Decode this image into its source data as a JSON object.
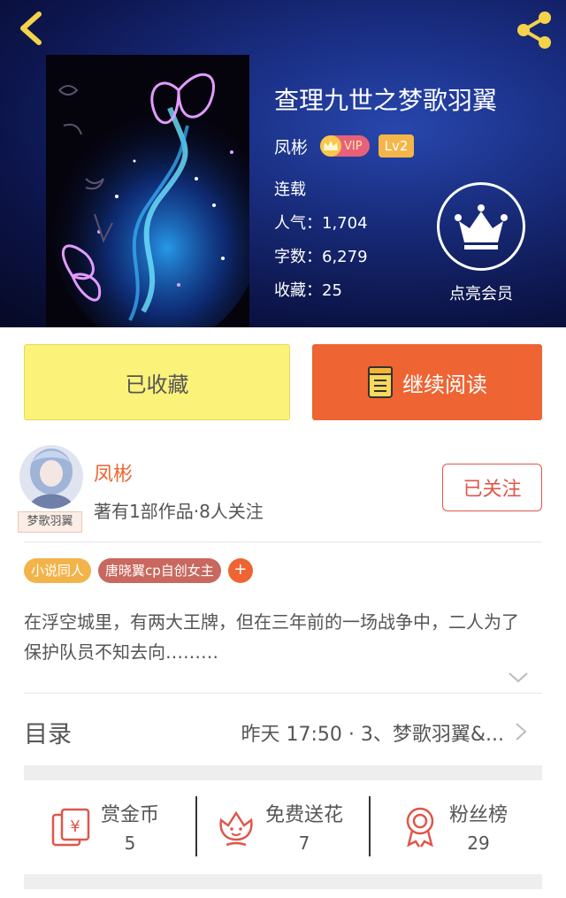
{
  "book": {
    "title": "查理九世之梦歌羽翼",
    "author": "凤彬",
    "vip": "VIP",
    "level": "Lv2",
    "status": "连载",
    "popularity": "人气：1,704",
    "words": "字数：6,279",
    "favorites": "收藏：25"
  },
  "member": {
    "label": "点亮会员"
  },
  "actions": {
    "collected": "已收藏",
    "continue_reading": "继续阅读"
  },
  "author": {
    "name": "凤彬",
    "info": "著有1部作品·8人关注",
    "avatar_tag": "梦歌羽翼",
    "follow": "已关注"
  },
  "tags": [
    "小说同人",
    "唐晓翼cp自创女主"
  ],
  "tag_add": "+",
  "synopsis": "在浮空城里，有两大王牌，但在三年前的一场战争中，二人为了保护队员不知去向………",
  "toc": {
    "title": "目录",
    "latest": "昨天 17:50 · 3、梦歌羽翼&..."
  },
  "stats": [
    {
      "label": "赏金币",
      "value": "5",
      "icon": "red-envelope-icon"
    },
    {
      "label": "免费送花",
      "value": "7",
      "icon": "flower-icon"
    },
    {
      "label": "粉丝榜",
      "value": "29",
      "icon": "medal-icon"
    }
  ],
  "colors": {
    "accent": "#ee6433",
    "collected_bg": "#fbf27a",
    "tag1": "#f2b44a",
    "tag2": "#c9685e"
  }
}
